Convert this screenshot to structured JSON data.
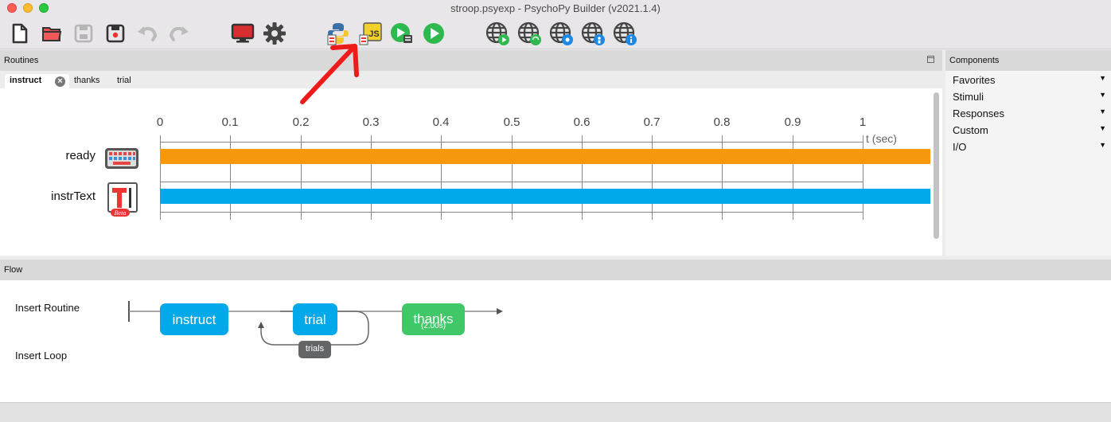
{
  "window": {
    "title": "stroop.psyexp - PsychoPy Builder (v2021.1.4)"
  },
  "toolbar": {
    "buttons": [
      {
        "name": "new-file-icon"
      },
      {
        "name": "open-folder-icon"
      },
      {
        "name": "save-icon"
      },
      {
        "name": "save-as-icon"
      },
      {
        "name": "undo-icon"
      },
      {
        "name": "redo-icon"
      },
      {
        "name": "monitor-icon"
      },
      {
        "name": "gear-icon"
      },
      {
        "name": "compile-python-icon"
      },
      {
        "name": "compile-js-icon",
        "label": "JS"
      },
      {
        "name": "runner-icon"
      },
      {
        "name": "run-icon"
      },
      {
        "name": "globe-run-icon"
      },
      {
        "name": "globe-sync-icon"
      },
      {
        "name": "globe-pavlovia-icon"
      },
      {
        "name": "globe-user-icon"
      },
      {
        "name": "globe-info-icon"
      }
    ]
  },
  "routines": {
    "header": "Routines",
    "tabs": [
      "instruct",
      "thanks",
      "trial"
    ],
    "active_tab": "instruct",
    "timeline": {
      "ticks": [
        "0",
        "0.1",
        "0.2",
        "0.3",
        "0.4",
        "0.5",
        "0.6",
        "0.7",
        "0.8",
        "0.9",
        "1"
      ],
      "unit": "t (sec)",
      "components": [
        {
          "name": "ready",
          "icon": "keyboard-icon",
          "color": "#f5980c"
        },
        {
          "name": "instrText",
          "icon": "textbox-icon",
          "icon_badge": "Beta",
          "color": "#02a9ea"
        }
      ]
    }
  },
  "components_panel": {
    "header": "Components",
    "categories": [
      "Favorites",
      "Stimuli",
      "Responses",
      "Custom",
      "I/O"
    ]
  },
  "flow": {
    "header": "Flow",
    "insert_routine": "Insert Routine",
    "insert_loop": "Insert Loop",
    "routines": [
      {
        "label": "instruct",
        "sub": "",
        "color": "#02a9ea"
      },
      {
        "label": "trial",
        "sub": "",
        "color": "#02a9ea"
      },
      {
        "label": "thanks",
        "sub": "(2.00s)",
        "color": "#3fc768"
      }
    ],
    "loop": {
      "label": "trials"
    }
  },
  "annotation": {
    "color": "#ef1b1b",
    "icon": "red-arrow"
  }
}
